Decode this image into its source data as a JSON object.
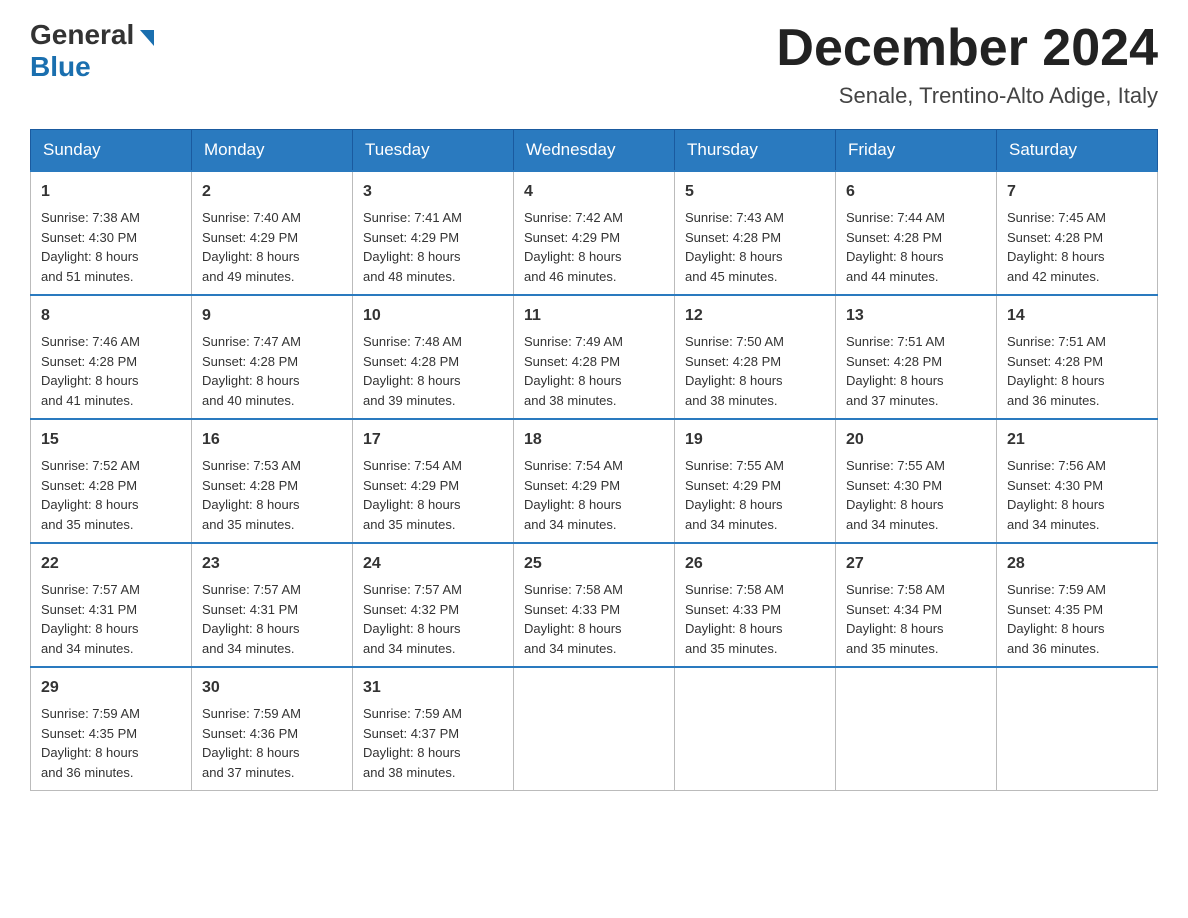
{
  "header": {
    "logo_line1": "General",
    "logo_line2": "Blue",
    "month_title": "December 2024",
    "location": "Senale, Trentino-Alto Adige, Italy"
  },
  "days_of_week": [
    "Sunday",
    "Monday",
    "Tuesday",
    "Wednesday",
    "Thursday",
    "Friday",
    "Saturday"
  ],
  "weeks": [
    [
      {
        "day": "1",
        "sunrise": "7:38 AM",
        "sunset": "4:30 PM",
        "daylight": "8 hours and 51 minutes."
      },
      {
        "day": "2",
        "sunrise": "7:40 AM",
        "sunset": "4:29 PM",
        "daylight": "8 hours and 49 minutes."
      },
      {
        "day": "3",
        "sunrise": "7:41 AM",
        "sunset": "4:29 PM",
        "daylight": "8 hours and 48 minutes."
      },
      {
        "day": "4",
        "sunrise": "7:42 AM",
        "sunset": "4:29 PM",
        "daylight": "8 hours and 46 minutes."
      },
      {
        "day": "5",
        "sunrise": "7:43 AM",
        "sunset": "4:28 PM",
        "daylight": "8 hours and 45 minutes."
      },
      {
        "day": "6",
        "sunrise": "7:44 AM",
        "sunset": "4:28 PM",
        "daylight": "8 hours and 44 minutes."
      },
      {
        "day": "7",
        "sunrise": "7:45 AM",
        "sunset": "4:28 PM",
        "daylight": "8 hours and 42 minutes."
      }
    ],
    [
      {
        "day": "8",
        "sunrise": "7:46 AM",
        "sunset": "4:28 PM",
        "daylight": "8 hours and 41 minutes."
      },
      {
        "day": "9",
        "sunrise": "7:47 AM",
        "sunset": "4:28 PM",
        "daylight": "8 hours and 40 minutes."
      },
      {
        "day": "10",
        "sunrise": "7:48 AM",
        "sunset": "4:28 PM",
        "daylight": "8 hours and 39 minutes."
      },
      {
        "day": "11",
        "sunrise": "7:49 AM",
        "sunset": "4:28 PM",
        "daylight": "8 hours and 38 minutes."
      },
      {
        "day": "12",
        "sunrise": "7:50 AM",
        "sunset": "4:28 PM",
        "daylight": "8 hours and 38 minutes."
      },
      {
        "day": "13",
        "sunrise": "7:51 AM",
        "sunset": "4:28 PM",
        "daylight": "8 hours and 37 minutes."
      },
      {
        "day": "14",
        "sunrise": "7:51 AM",
        "sunset": "4:28 PM",
        "daylight": "8 hours and 36 minutes."
      }
    ],
    [
      {
        "day": "15",
        "sunrise": "7:52 AM",
        "sunset": "4:28 PM",
        "daylight": "8 hours and 35 minutes."
      },
      {
        "day": "16",
        "sunrise": "7:53 AM",
        "sunset": "4:28 PM",
        "daylight": "8 hours and 35 minutes."
      },
      {
        "day": "17",
        "sunrise": "7:54 AM",
        "sunset": "4:29 PM",
        "daylight": "8 hours and 35 minutes."
      },
      {
        "day": "18",
        "sunrise": "7:54 AM",
        "sunset": "4:29 PM",
        "daylight": "8 hours and 34 minutes."
      },
      {
        "day": "19",
        "sunrise": "7:55 AM",
        "sunset": "4:29 PM",
        "daylight": "8 hours and 34 minutes."
      },
      {
        "day": "20",
        "sunrise": "7:55 AM",
        "sunset": "4:30 PM",
        "daylight": "8 hours and 34 minutes."
      },
      {
        "day": "21",
        "sunrise": "7:56 AM",
        "sunset": "4:30 PM",
        "daylight": "8 hours and 34 minutes."
      }
    ],
    [
      {
        "day": "22",
        "sunrise": "7:57 AM",
        "sunset": "4:31 PM",
        "daylight": "8 hours and 34 minutes."
      },
      {
        "day": "23",
        "sunrise": "7:57 AM",
        "sunset": "4:31 PM",
        "daylight": "8 hours and 34 minutes."
      },
      {
        "day": "24",
        "sunrise": "7:57 AM",
        "sunset": "4:32 PM",
        "daylight": "8 hours and 34 minutes."
      },
      {
        "day": "25",
        "sunrise": "7:58 AM",
        "sunset": "4:33 PM",
        "daylight": "8 hours and 34 minutes."
      },
      {
        "day": "26",
        "sunrise": "7:58 AM",
        "sunset": "4:33 PM",
        "daylight": "8 hours and 35 minutes."
      },
      {
        "day": "27",
        "sunrise": "7:58 AM",
        "sunset": "4:34 PM",
        "daylight": "8 hours and 35 minutes."
      },
      {
        "day": "28",
        "sunrise": "7:59 AM",
        "sunset": "4:35 PM",
        "daylight": "8 hours and 36 minutes."
      }
    ],
    [
      {
        "day": "29",
        "sunrise": "7:59 AM",
        "sunset": "4:35 PM",
        "daylight": "8 hours and 36 minutes."
      },
      {
        "day": "30",
        "sunrise": "7:59 AM",
        "sunset": "4:36 PM",
        "daylight": "8 hours and 37 minutes."
      },
      {
        "day": "31",
        "sunrise": "7:59 AM",
        "sunset": "4:37 PM",
        "daylight": "8 hours and 38 minutes."
      },
      null,
      null,
      null,
      null
    ]
  ],
  "labels": {
    "sunrise": "Sunrise:",
    "sunset": "Sunset:",
    "daylight": "Daylight:"
  }
}
